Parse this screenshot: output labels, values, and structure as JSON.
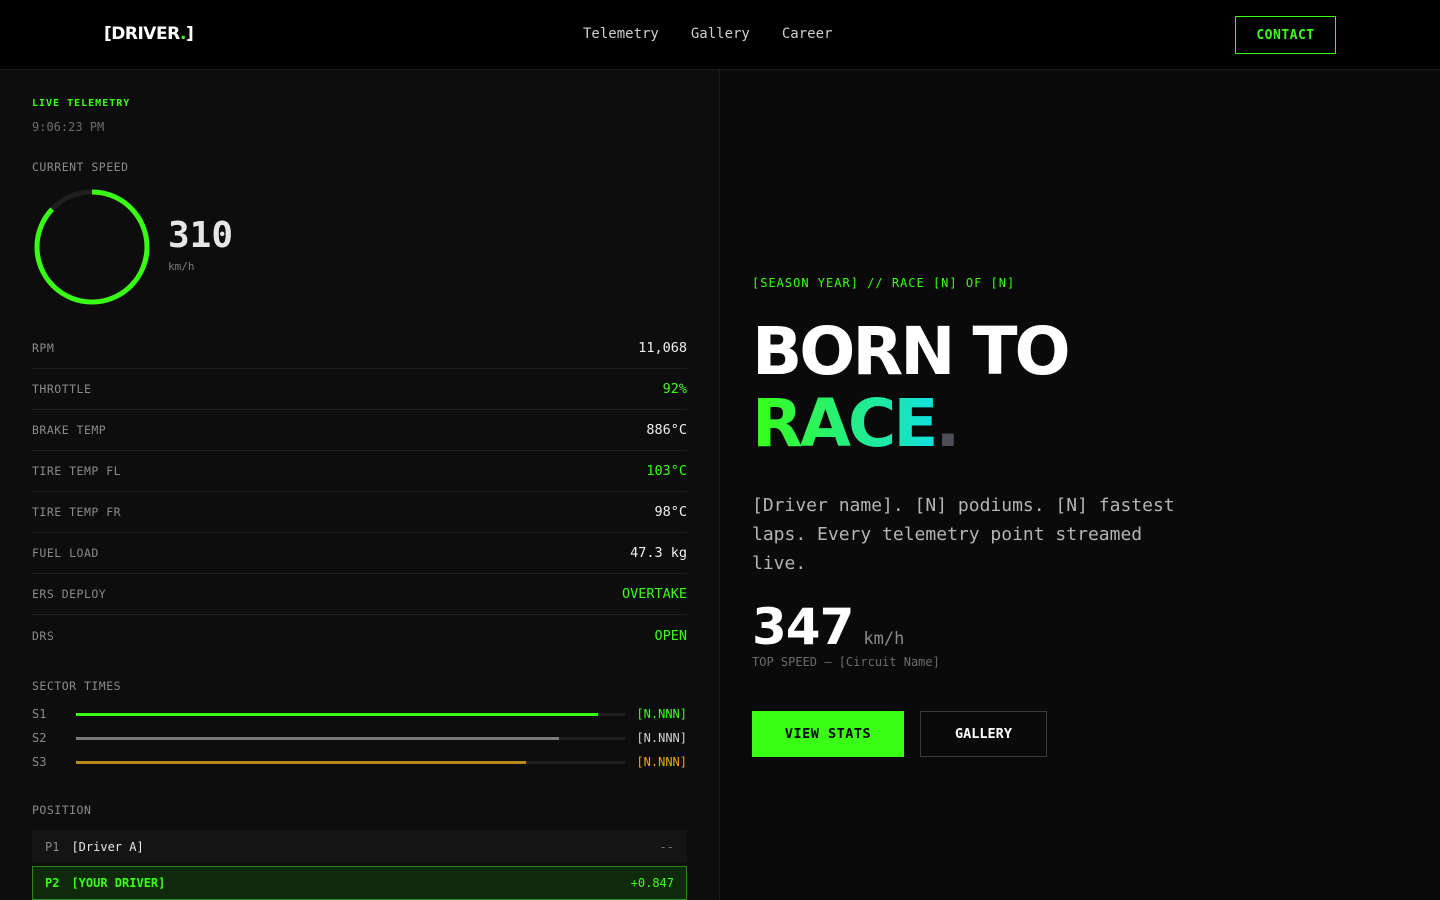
{
  "header": {
    "logo_text": "[DRIVER",
    "logo_dot": ".",
    "logo_close": "]",
    "nav": [
      "Telemetry",
      "Gallery",
      "Career"
    ],
    "contact_label": "CONTACT"
  },
  "telemetry": {
    "title": "LIVE TELEMETRY",
    "clock": "9:06:23 PM",
    "speed_label": "CURRENT SPEED",
    "speed_value": "310",
    "speed_unit": "km/h",
    "speed_gauge_fraction": 0.87,
    "metrics": [
      {
        "label": "RPM",
        "value": "11,068",
        "accent": false
      },
      {
        "label": "THROTTLE",
        "value": "92%",
        "accent": true
      },
      {
        "label": "BRAKE TEMP",
        "value": "886°C",
        "accent": false
      },
      {
        "label": "TIRE TEMP FL",
        "value": "103°C",
        "accent": true
      },
      {
        "label": "TIRE TEMP FR",
        "value": "98°C",
        "accent": false
      },
      {
        "label": "FUEL LOAD",
        "value": "47.3 kg",
        "accent": false
      },
      {
        "label": "ERS DEPLOY",
        "value": "OVERTAKE",
        "accent": true
      },
      {
        "label": "DRS",
        "value": "OPEN",
        "accent": true
      }
    ],
    "sectors_label": "SECTOR TIMES",
    "sectors": [
      {
        "name": "S1",
        "time": "[N.NNN]",
        "fill": 0.95,
        "color": "#39ff14"
      },
      {
        "name": "S2",
        "time": "[N.NNN]",
        "fill": 0.88,
        "color": "#7a7a7a"
      },
      {
        "name": "S3",
        "time": "[N.NNN]",
        "fill": 0.82,
        "color": "#b8891a"
      }
    ],
    "position_label": "POSITION",
    "positions": [
      {
        "pos": "P1",
        "driver": "[Driver A]",
        "gap": "--"
      },
      {
        "pos": "P2",
        "driver": "[YOUR DRIVER]",
        "gap": "+0.847"
      }
    ]
  },
  "hero": {
    "season": "[SEASON YEAR] // RACE [N] OF [N]",
    "line1": "BORN TO",
    "line2": "RACE",
    "period": ".",
    "description": "[Driver name]. [N] podiums. [N] fastest laps. Every telemetry point streamed live.",
    "top_speed": "347",
    "top_speed_unit": "km/h",
    "top_speed_caption": "TOP SPEED — [Circuit Name]",
    "btn_stats": "VIEW STATS",
    "btn_gallery": "GALLERY"
  },
  "colors": {
    "accent": "#39ff14",
    "accent_cyan": "#12e0e0",
    "background": "#0a0a0a"
  }
}
